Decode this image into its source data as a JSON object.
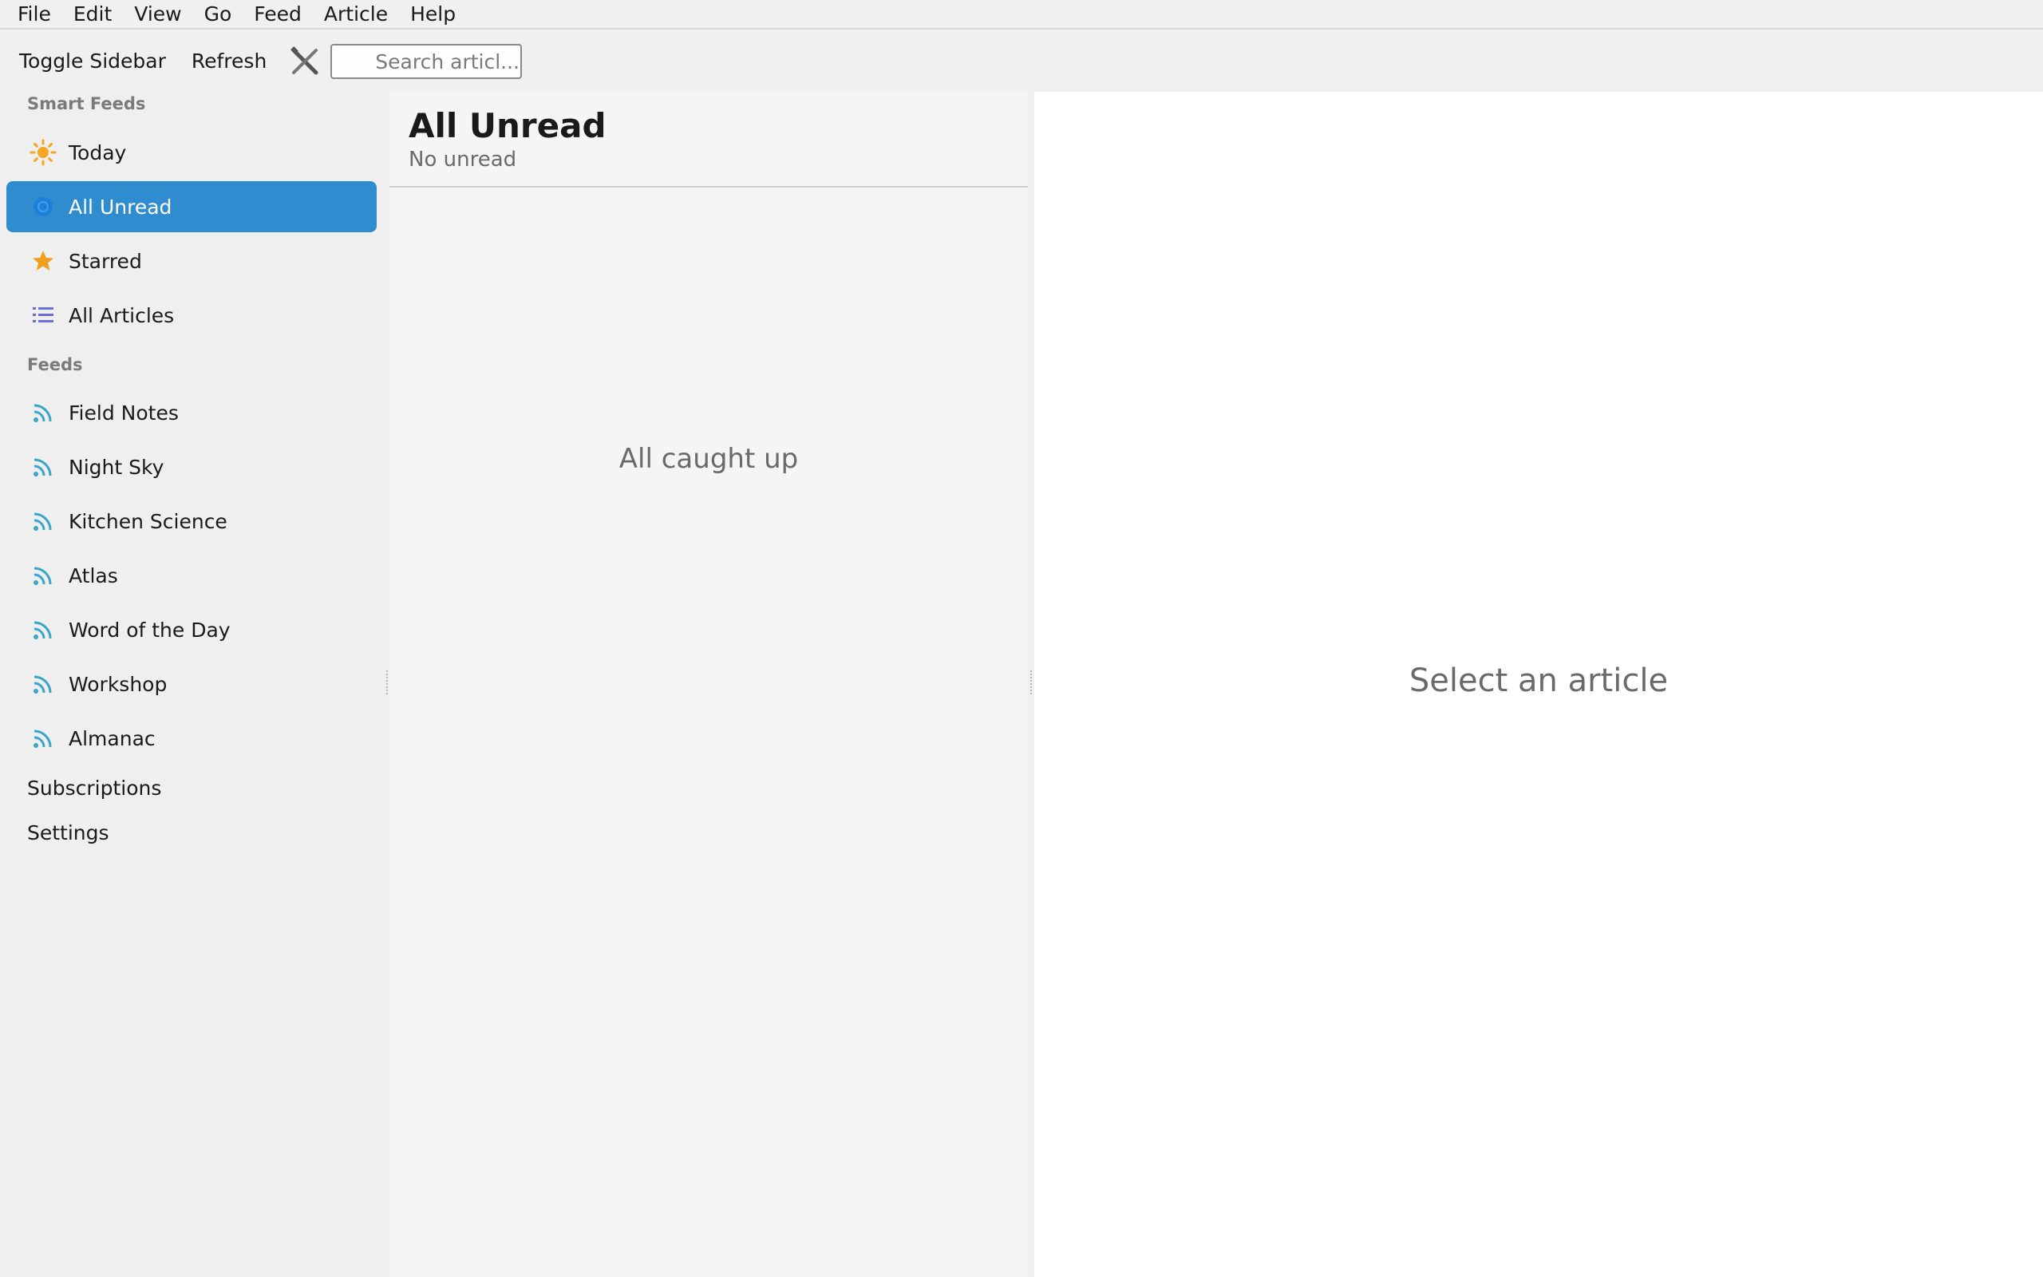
{
  "menubar": {
    "items": [
      "File",
      "Edit",
      "View",
      "Go",
      "Feed",
      "Article",
      "Help"
    ]
  },
  "toolbar": {
    "toggle_sidebar_label": "Toggle Sidebar",
    "refresh_label": "Refresh",
    "tools_icon": "tools-icon",
    "search_placeholder": "Search articl..."
  },
  "sidebar": {
    "smart_feeds_header": "Smart Feeds",
    "smart_feeds": [
      {
        "label": "Today",
        "icon": "sun-icon",
        "icon_color": "#f5a623"
      },
      {
        "label": "All Unread",
        "icon": "unread-circle-icon",
        "icon_color": "#1e7fd6",
        "selected": true
      },
      {
        "label": "Starred",
        "icon": "star-icon",
        "icon_color": "#f0a020"
      },
      {
        "label": "All Articles",
        "icon": "list-icon",
        "icon_color": "#6b6fd8"
      }
    ],
    "feeds_header": "Feeds",
    "feeds": [
      {
        "label": "Field Notes",
        "icon": "rss-icon"
      },
      {
        "label": "Night Sky",
        "icon": "rss-icon"
      },
      {
        "label": "Kitchen Science",
        "icon": "rss-icon"
      },
      {
        "label": "Atlas",
        "icon": "rss-icon"
      },
      {
        "label": "Word of the Day",
        "icon": "rss-icon"
      },
      {
        "label": "Workshop",
        "icon": "rss-icon"
      },
      {
        "label": "Almanac",
        "icon": "rss-icon"
      }
    ],
    "subscriptions_label": "Subscriptions",
    "settings_label": "Settings",
    "rss_color": "#3aa6c8",
    "selected_color": "#2f8ccf"
  },
  "article_list": {
    "title": "All Unread",
    "subtitle": "No unread",
    "empty_message": "All caught up"
  },
  "reader": {
    "empty_message": "Select an article"
  }
}
